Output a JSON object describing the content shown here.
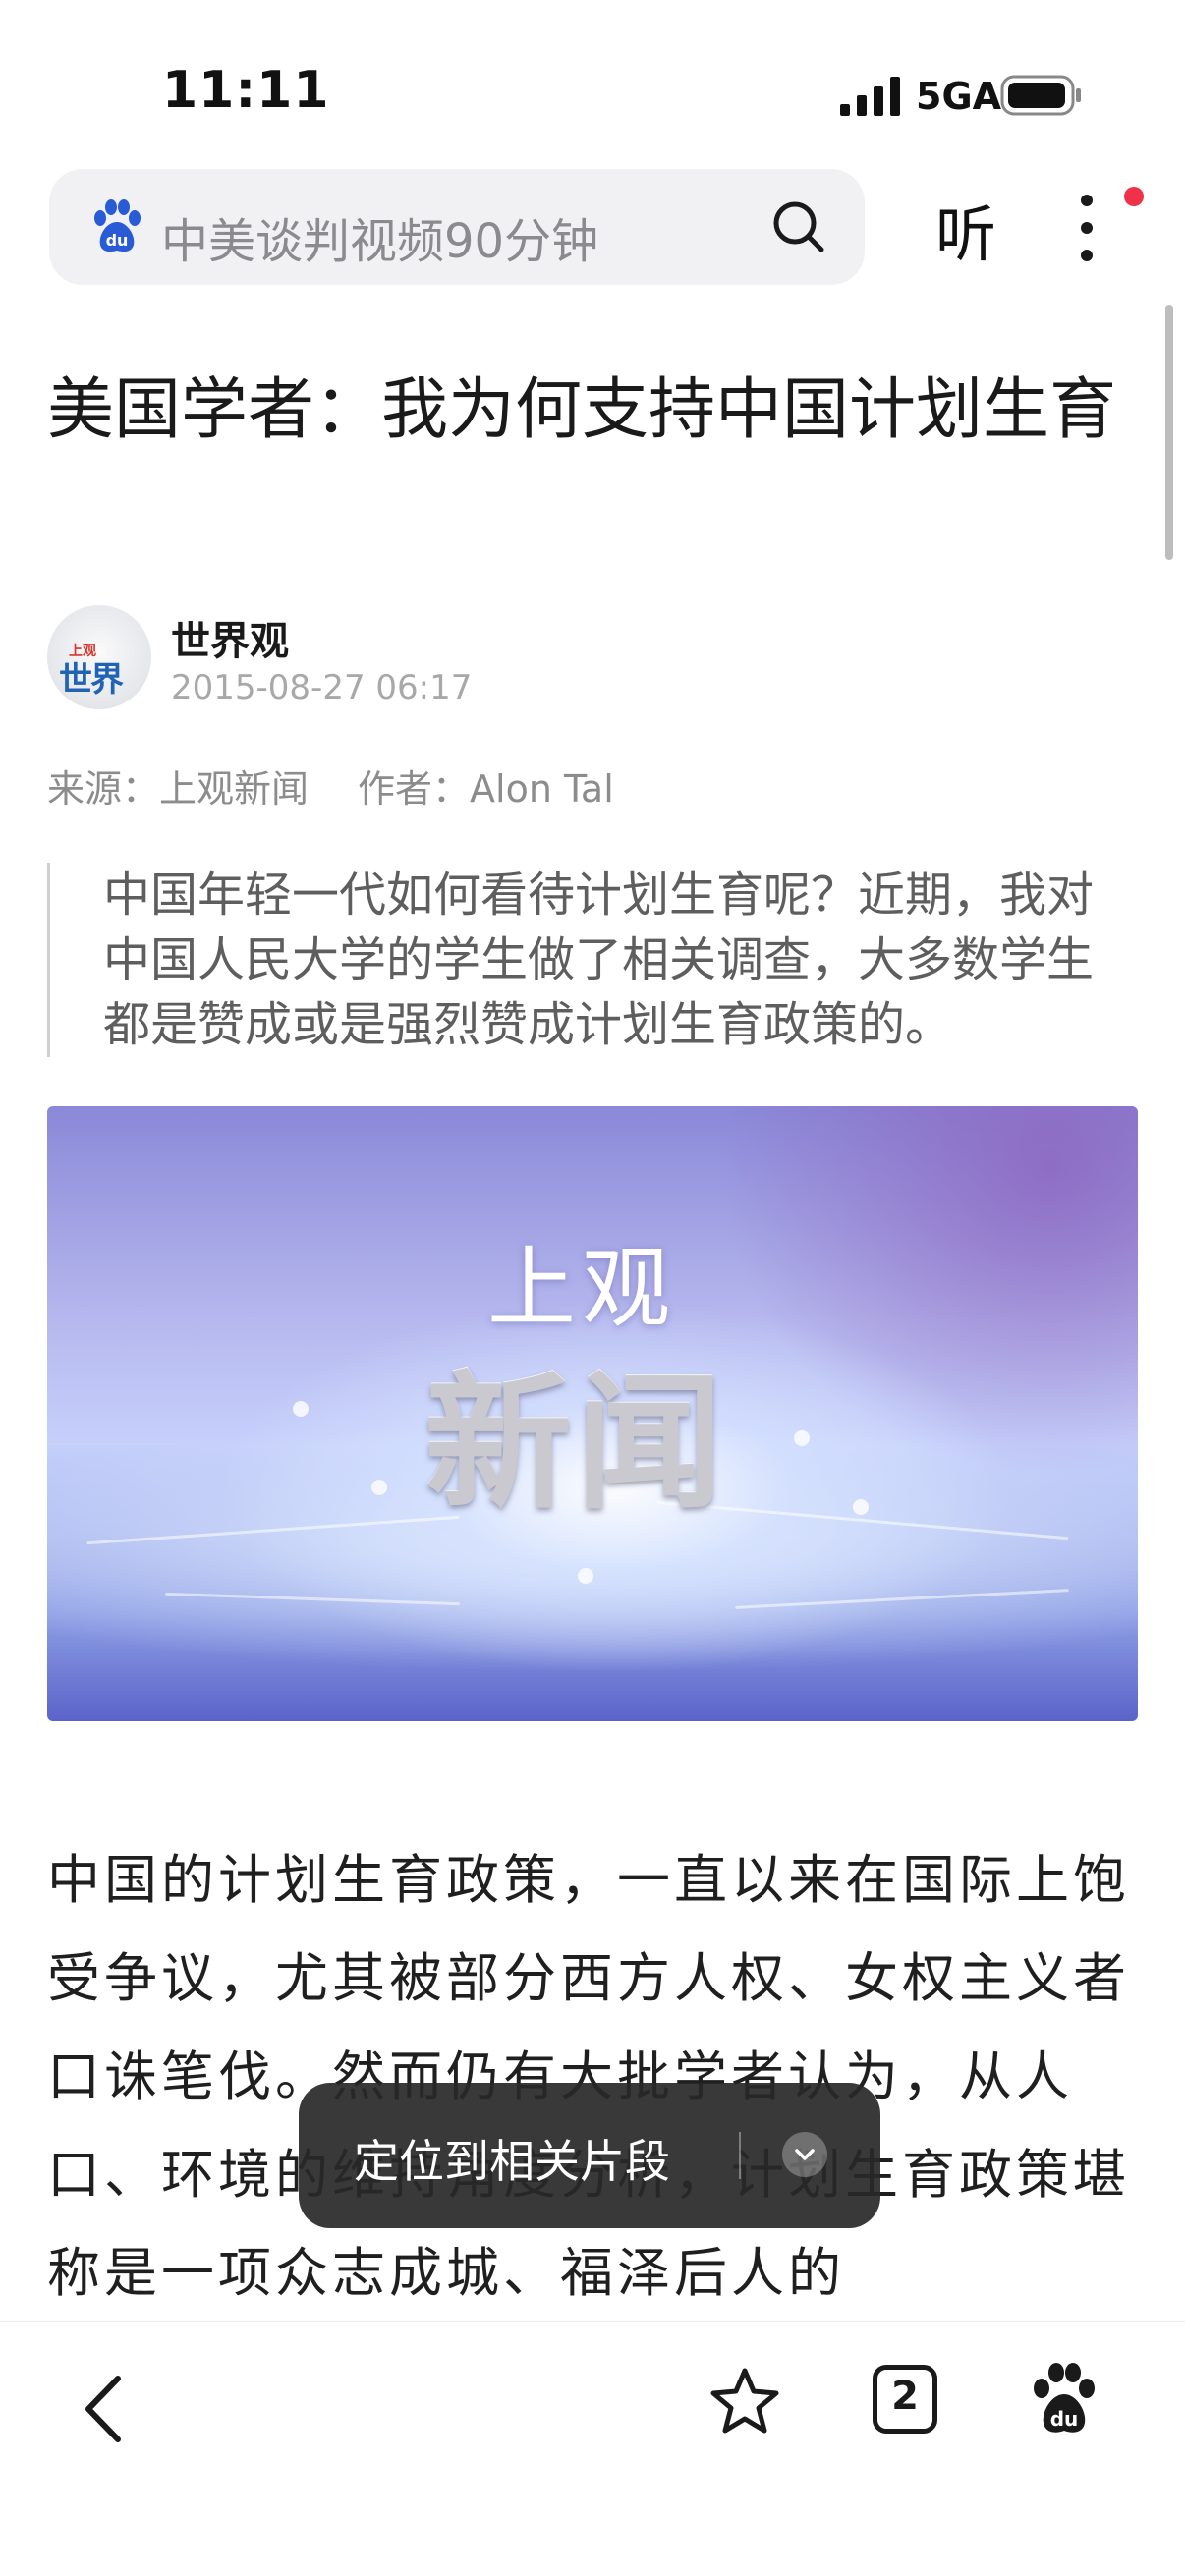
{
  "status_bar": {
    "time": "11:11",
    "network": "5GA"
  },
  "search_bar": {
    "query": "中美谈判视频90分钟",
    "listen_label": "听"
  },
  "article": {
    "title": "美国学者：我为何支持中国计划生育",
    "author": {
      "name": "世界观",
      "publish_time": "2015-08-27 06:17",
      "avatar_text_small": "上观",
      "avatar_text_big": "世界观"
    },
    "source_label": "来源：上观新闻",
    "author_label": "作者：Alon Tal",
    "summary": "中国年轻一代如何看待计划生育呢？近期，我对中国人民大学的学生做了相关调查，大多数学生都是赞成或是强烈赞成计划生育政策的。",
    "image": {
      "brand_small": "上观",
      "brand_big": "新闻"
    },
    "body": "中国的计划生育政策，一直以来在国际上饱受争议，尤其被部分西方人权、女权主义者口诛笔伐。然而仍有大批学者认为，从人口、环境的维持角度分析，计划生育政策堪称是一项众志成城、福泽后人的"
  },
  "toast": {
    "label": "定位到相关片段"
  },
  "bottom_bar": {
    "tab_count": "2"
  },
  "colors": {
    "notification_dot": "#f0314a",
    "baidu_blue": "#2a5bd7"
  },
  "icons": [
    "signal-icon",
    "battery-icon",
    "baidu-paw-icon",
    "search-icon",
    "more-icon",
    "back-icon",
    "star-icon",
    "tabs-icon",
    "baidu-home-icon",
    "chevron-down-icon"
  ]
}
